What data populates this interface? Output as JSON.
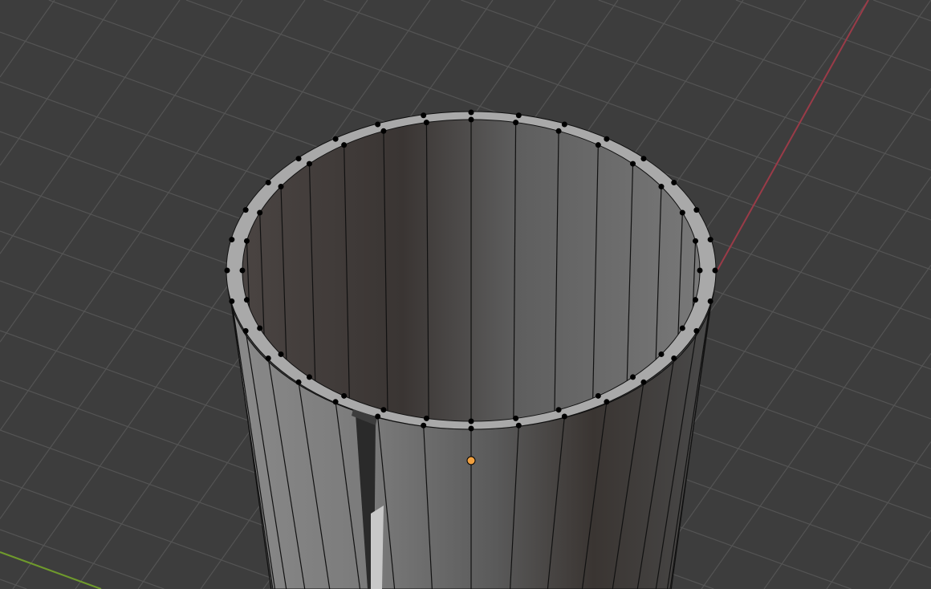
{
  "viewport": {
    "mode": "edit-mesh",
    "object": "cylinder",
    "vertex_count_per_ring": 32,
    "selected_vertices": 1
  },
  "colors": {
    "background": "#3d3d3d",
    "grid": "#545454",
    "x_axis": "#9a3b48",
    "y_axis": "#6f9a2c",
    "rim": "#a9a9a9",
    "wall_light": "#7a7a7a",
    "wall_dark": "#3a3633",
    "vertex": "#000000",
    "selected_vertex": "#f0a040"
  }
}
